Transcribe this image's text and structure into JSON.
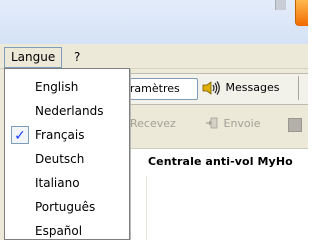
{
  "menubar": {
    "langue_label": "Langue",
    "help_label": "?"
  },
  "tabs": {
    "params_label": "Paramètres",
    "messages_label": "Messages"
  },
  "toolbar": {
    "recevez_label": "Recevez",
    "envoie_label": "Envoie"
  },
  "panel": {
    "title": "Centrale anti-vol MyHo"
  },
  "language_menu": {
    "items": [
      {
        "label": "English",
        "checked": false
      },
      {
        "label": "Nederlands",
        "checked": false
      },
      {
        "label": "Français",
        "checked": true
      },
      {
        "label": "Deutsch",
        "checked": false
      },
      {
        "label": "Italiano",
        "checked": false
      },
      {
        "label": "Português",
        "checked": false
      },
      {
        "label": "Español",
        "checked": false
      }
    ],
    "check_glyph": "✓"
  }
}
